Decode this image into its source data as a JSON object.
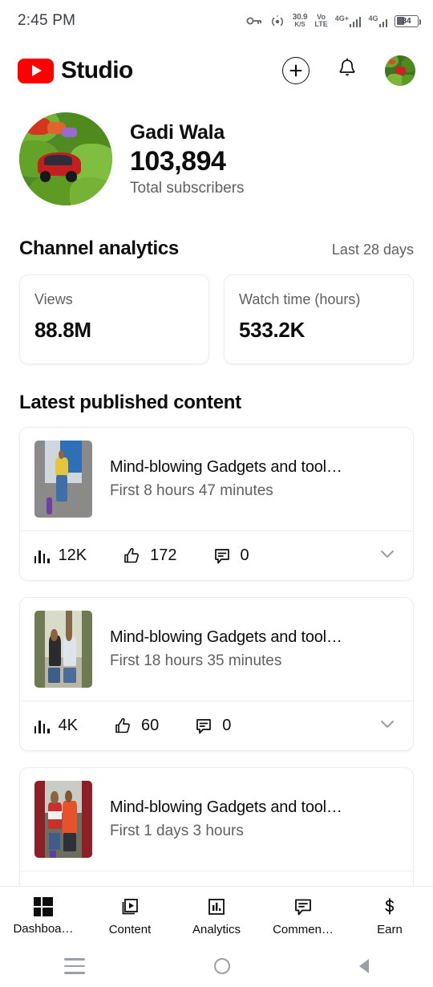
{
  "status_bar": {
    "time": "2:45 PM",
    "data_speed_value": "30.9",
    "data_speed_unit": "K/S",
    "volte_top": "Vo",
    "volte_bottom": "LTE",
    "network_1": "4G+",
    "network_2": "4G",
    "battery_level": "34",
    "icons": [
      "vpn-key-icon",
      "hotspot-icon",
      "data-speed-icon",
      "volte-icon",
      "signal-icon",
      "signal-icon",
      "battery-icon"
    ]
  },
  "app_bar": {
    "brand": "Studio",
    "logo_icon": "youtube-logo-icon",
    "create_icon": "plus-circle-icon",
    "notifications_icon": "bell-icon",
    "avatar_icon": "account-avatar"
  },
  "channel": {
    "name": "Gadi Wala",
    "subscriber_count": "103,894",
    "subscriber_label": "Total subscribers"
  },
  "analytics": {
    "title": "Channel analytics",
    "date_range": "Last 28 days",
    "metrics": [
      {
        "label": "Views",
        "value": "88.8M"
      },
      {
        "label": "Watch time (hours)",
        "value": "533.2K"
      }
    ]
  },
  "latest_content": {
    "title": "Latest published content",
    "videos": [
      {
        "title": "Mind-blowing Gadgets and tool…",
        "subtitle": "First 8 hours 47 minutes",
        "views": "12K",
        "likes": "172",
        "comments": "0",
        "views_icon": "bar-chart-icon",
        "likes_icon": "thumbs-up-icon",
        "comments_icon": "comment-icon",
        "expand_icon": "chevron-down-icon"
      },
      {
        "title": "Mind-blowing Gadgets and tool…",
        "subtitle": "First 18 hours 35 minutes",
        "views": "4K",
        "likes": "60",
        "comments": "0",
        "views_icon": "bar-chart-icon",
        "likes_icon": "thumbs-up-icon",
        "comments_icon": "comment-icon",
        "expand_icon": "chevron-down-icon"
      },
      {
        "title": "Mind-blowing Gadgets and tool…",
        "subtitle": "First 1 days 3 hours",
        "views": "",
        "likes": "",
        "comments": "",
        "views_icon": "bar-chart-icon",
        "likes_icon": "thumbs-up-icon",
        "comments_icon": "comment-icon",
        "expand_icon": "chevron-down-icon"
      }
    ]
  },
  "bottom_nav": {
    "items": [
      {
        "label": "Dashboa…",
        "icon": "dashboard-grid-icon",
        "active": true
      },
      {
        "label": "Content",
        "icon": "video-content-icon",
        "active": false
      },
      {
        "label": "Analytics",
        "icon": "analytics-bar-icon",
        "active": false
      },
      {
        "label": "Commen…",
        "icon": "comment-icon",
        "active": false
      },
      {
        "label": "Earn",
        "icon": "dollar-icon",
        "active": false
      }
    ]
  },
  "system_nav": {
    "recents_icon": "recents-icon",
    "home_icon": "home-circle-icon",
    "back_icon": "back-triangle-icon"
  },
  "colors": {
    "brand_red": "#ff0000",
    "text_primary": "#0d0d0d",
    "text_secondary": "#606060",
    "card_border": "#ececec"
  }
}
